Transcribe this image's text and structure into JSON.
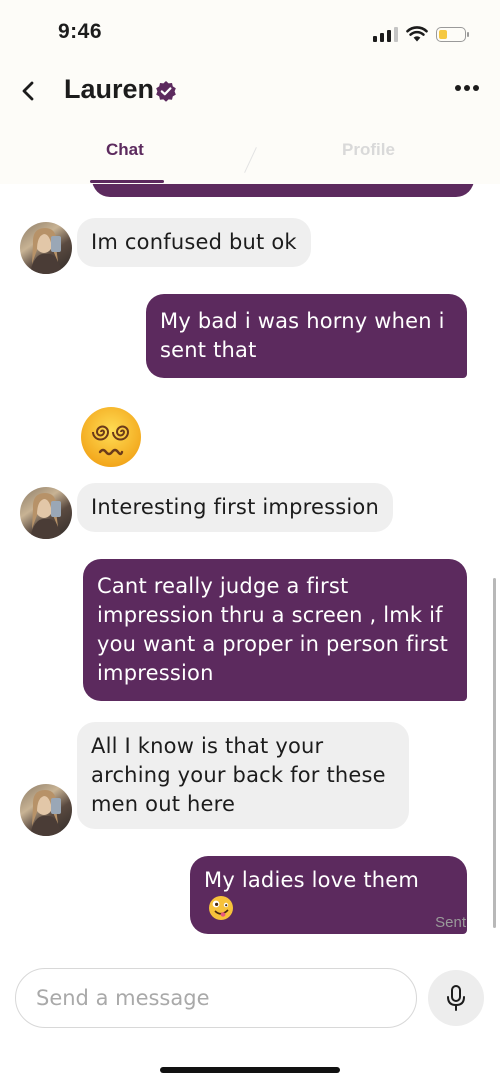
{
  "status_bar": {
    "time": "9:46",
    "battery_level": 0.35
  },
  "header": {
    "contact_name": "Lauren",
    "icons": [
      "back-chevron-icon",
      "verified-badge-icon",
      "more-options-icon"
    ]
  },
  "tabs": [
    {
      "label": "Chat",
      "active": true
    },
    {
      "label": "Profile",
      "active": false
    }
  ],
  "messages": [
    {
      "from": "them",
      "text": "Im confused but ok"
    },
    {
      "from": "me",
      "text": "My bad i was horny when i sent that"
    },
    {
      "from": "them",
      "emoji": "face-with-spiral-eyes"
    },
    {
      "from": "them",
      "text": "Interesting first impression"
    },
    {
      "from": "me",
      "text": "Cant really judge a first impression thru a screen , lmk if you want a proper in person first impression"
    },
    {
      "from": "them",
      "text": "All I know is that your arching your back for these men out here"
    },
    {
      "from": "me",
      "text": "My ladies love them",
      "emoji": "zany-face"
    }
  ],
  "delivery_status": "Sent",
  "composer": {
    "placeholder": "Send a message",
    "value": ""
  },
  "colors": {
    "accent": "#5c2a5e",
    "incoming_bubble": "#efefef",
    "muted_text": "#9a9a9a"
  }
}
